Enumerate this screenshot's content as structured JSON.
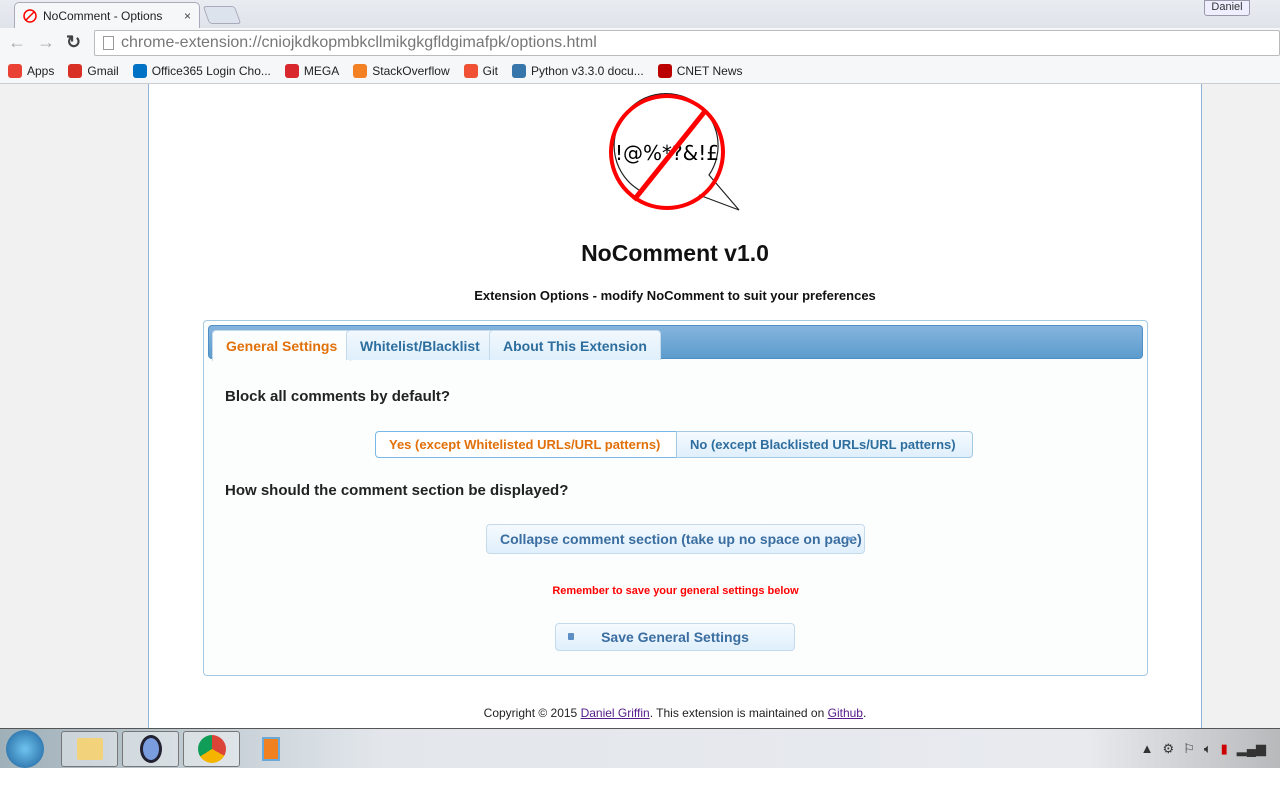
{
  "browser": {
    "tab_title": "NoComment - Options",
    "tab_close": "×",
    "user": "Daniel",
    "url": "chrome-extension://cniojkdkopmbkcllmikgkgfldgimafpk/options.html",
    "nav_icons": [
      "back-icon",
      "forward-icon",
      "reload-icon"
    ],
    "bookmarks": [
      {
        "label": "Apps",
        "icon": "apps-grid-icon",
        "color": "#e94235"
      },
      {
        "label": "Gmail",
        "icon": "gmail-icon",
        "color": "#d93025"
      },
      {
        "label": "Office365 Login Cho...",
        "icon": "outlook-icon",
        "color": "#0072c6"
      },
      {
        "label": "MEGA",
        "icon": "mega-icon",
        "color": "#d9272e"
      },
      {
        "label": "StackOverflow",
        "icon": "stackoverflow-icon",
        "color": "#f48024"
      },
      {
        "label": "Git",
        "icon": "git-icon",
        "color": "#f05033"
      },
      {
        "label": "Python v3.3.0 docu...",
        "icon": "python-icon",
        "color": "#3776ab"
      },
      {
        "label": "CNET News",
        "icon": "cnet-icon",
        "color": "#b00"
      }
    ]
  },
  "page": {
    "logo_text": "!@%*?&!£",
    "title": "NoComment v1.0",
    "subtitle": "Extension Options - modify NoComment to suit your preferences",
    "tabs": [
      {
        "label": "General Settings",
        "active": true
      },
      {
        "label": "Whitelist/Blacklist"
      },
      {
        "label": "About This Extension"
      }
    ],
    "q1": "Block all comments by default?",
    "q1_options": [
      {
        "label": "Yes (except Whitelisted URLs/URL patterns)",
        "selected": true
      },
      {
        "label": "No (except Blacklisted URLs/URL patterns)"
      }
    ],
    "q2": "How should the comment section be displayed?",
    "q2_selected": "Collapse comment section (take up no space on page)",
    "warning": "Remember to save your general settings below",
    "save_label": "Save General Settings",
    "footer": {
      "pre": "Copyright © 2015 ",
      "author": "Daniel Griffin",
      "mid": ". This extension is maintained on ",
      "link": "Github",
      "post": "."
    },
    "accent": "#e17009",
    "warning_color": "#ff0000"
  },
  "taskbar": {
    "apps": [
      "windows-explorer-icon",
      "keepass-icon",
      "chrome-icon",
      "media-player-icon"
    ],
    "tray": [
      "show-hidden-icon",
      "network-sync-icon",
      "action-center-flag-icon",
      "volume-icon",
      "power-icon",
      "signal-icon"
    ]
  }
}
